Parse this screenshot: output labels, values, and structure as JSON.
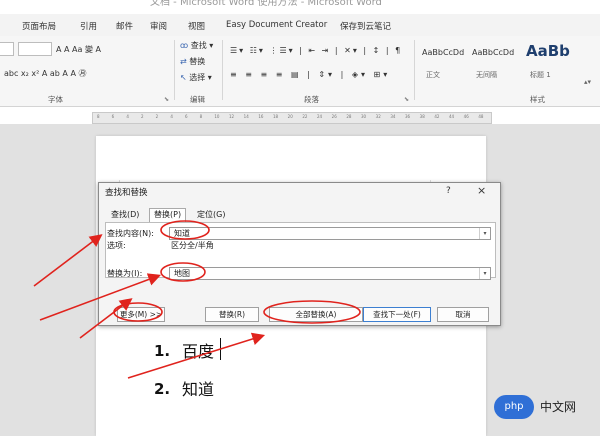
{
  "window": {
    "title": "文档 - Microsoft Word 使用方法 - Microsoft Word"
  },
  "menubar": {
    "items": [
      "页面布局",
      "引用",
      "邮件",
      "审阅",
      "视图",
      "Easy Document Creator",
      "保存到云笔记"
    ]
  },
  "ribbon": {
    "font_group_label": "字体",
    "font_row1": "A A  Aa  變  A",
    "font_row2": "abc x₂ x²  A  ab  A  A  ㊊",
    "edit_group_label": "编辑",
    "edit_find": "查找",
    "edit_replace": "替换",
    "edit_select": "选择",
    "para_group_label": "段落",
    "styles_group_label": "样式",
    "styles": [
      {
        "sample": "AaBbCcDd",
        "name": "正文"
      },
      {
        "sample": "AaBbCcDd",
        "name": "无间隔"
      },
      {
        "sample": "AaBb",
        "name": "标题 1"
      }
    ]
  },
  "ruler": {
    "ticks": [
      "8",
      "6",
      "4",
      "2",
      "2",
      "4",
      "6",
      "8",
      "10",
      "12",
      "14",
      "16",
      "18",
      "20",
      "22",
      "24",
      "26",
      "28",
      "30",
      "32",
      "34",
      "36",
      "38",
      "42",
      "44",
      "46",
      "48"
    ]
  },
  "dialog": {
    "title": "查找和替换",
    "help": "?",
    "close": "×",
    "tabs": [
      {
        "label": "查找(D)"
      },
      {
        "label": "替换(P)"
      },
      {
        "label": "定位(G)"
      }
    ],
    "find_label": "查找内容(N):",
    "find_value": "知道",
    "options_label": "选项:",
    "options_value": "区分全/半角",
    "replace_label": "替换为(I):",
    "replace_value": "地图",
    "buttons": {
      "more": "更多(M) >>",
      "replace": "替换(R)",
      "replace_all": "全部替换(A)",
      "find_next": "查找下一处(F)",
      "cancel": "取消"
    }
  },
  "document": {
    "items": [
      {
        "number": "1.",
        "text": "百度"
      },
      {
        "number": "2.",
        "text": "知道"
      }
    ]
  },
  "watermark": {
    "logo": "php",
    "text": "中文网"
  },
  "colors": {
    "annotation_red": "#e0231d",
    "find_next_border": "#3c7fd1"
  }
}
